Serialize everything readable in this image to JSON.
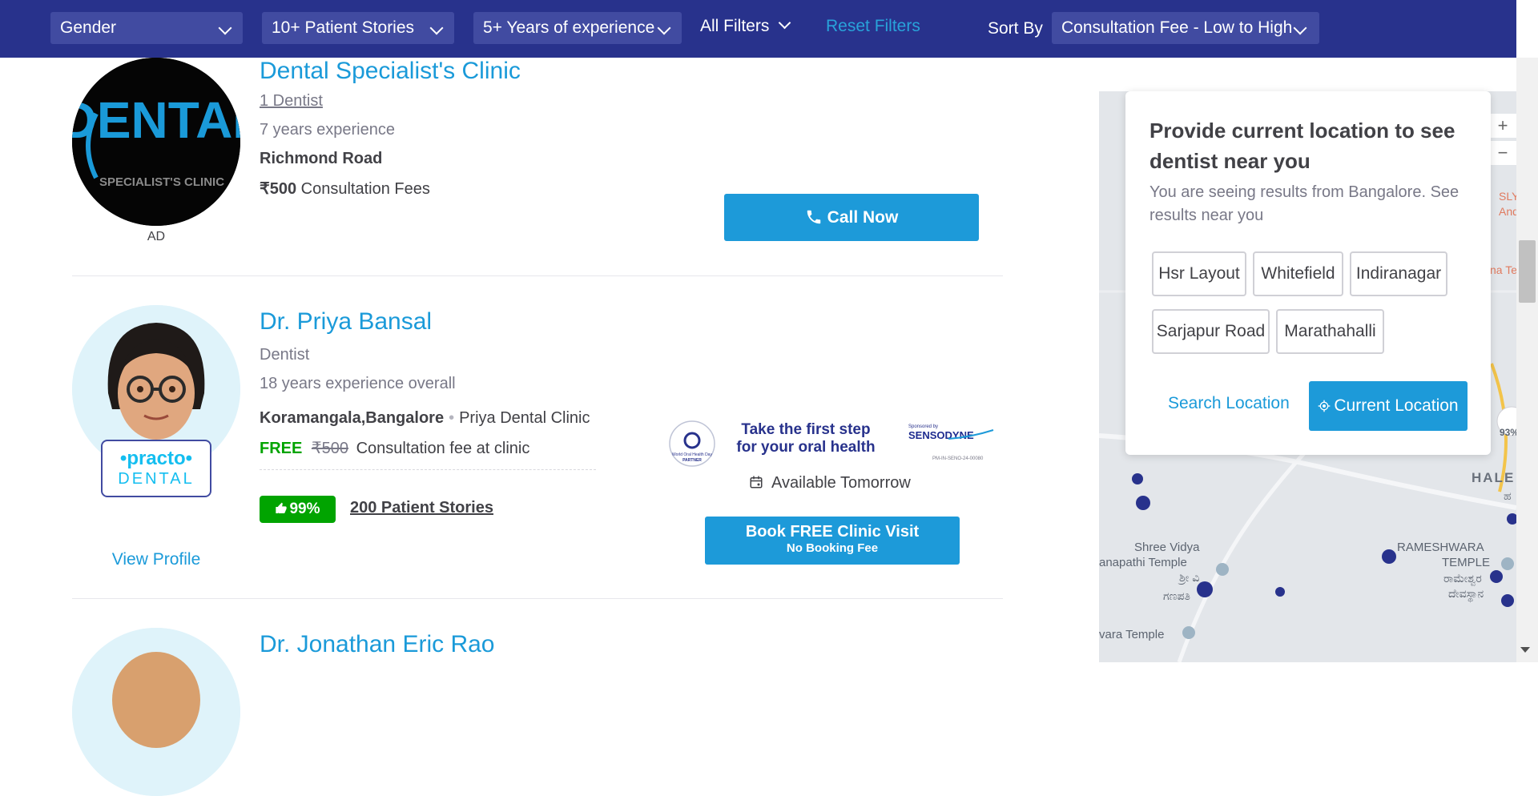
{
  "filters": {
    "gender": "Gender",
    "stories": "10+ Patient Stories",
    "experience": "5+ Years of experience",
    "all_filters": "All Filters",
    "reset": "Reset Filters",
    "sort_by_label": "Sort By",
    "sort_value": "Consultation Fee - Low to High"
  },
  "listings": [
    {
      "name": "Dental Specialist's Clinic",
      "specialty": "1 Dentist",
      "experience": "7 years experience",
      "location": "Richmond Road",
      "fee": "₹500",
      "fee_label": "Consultation Fees",
      "ad_label": "AD",
      "cta": "Call Now",
      "logo_text_top": "DENTAL",
      "logo_text_bottom": "SPECIALIST'S CLINIC"
    },
    {
      "name": "Dr. Priya Bansal",
      "specialty": "Dentist",
      "experience": "18 years experience overall",
      "location": "Koramangala,Bangalore",
      "clinic": "Priya Dental Clinic",
      "free": "FREE",
      "old_fee": "₹500",
      "fee_label": "Consultation fee at clinic",
      "rating": "99%",
      "stories": "200 Patient Stories",
      "view_profile": "View Profile",
      "promo_text": "Take the first step for your oral health",
      "availability": "Available Tomorrow",
      "cta_main": "Book FREE Clinic Visit",
      "cta_sub": "No Booking Fee",
      "partner_brand": "•practo•",
      "partner_sub": "DENTAL",
      "sponsor": "SENSODYNE",
      "sponsored_by": "Sponsored by",
      "partner_label": "PARTNER",
      "wohd": "World Oral Health Day",
      "sponsor_code": "PM-IN-SENO-24-00080"
    },
    {
      "name": "Dr. Jonathan Eric Rao"
    }
  ],
  "location_popup": {
    "title": "Provide current location to see dentist near you",
    "subtitle": "You are seeing results from Bangalore. See results near you",
    "chips": [
      "Hsr Layout",
      "Whitefield",
      "Indiranagar",
      "Sarjapur Road",
      "Marathahalli"
    ],
    "search_location": "Search Location",
    "current_location": "Current Location"
  },
  "map": {
    "zoom_in": "+",
    "zoom_out": "−",
    "labels": {
      "shree": "Shree Vidya",
      "ganapathi": "anapathi Temple",
      "rameshwara": "RAMESHWARA",
      "temple": "TEMPLE",
      "hale": "HALE",
      "vara": "vara Temple",
      "rating": "93%",
      "sly": "SLY",
      "and": "And",
      "na": "na Tem",
      "kn_ganapathi": "ಶ್ರೀ ವಿ",
      "kn_ganapathi2": "ಗಣಪತಿ",
      "kn_rameshwara": "ರಾಮೇಶ್ವರ",
      "kn_temple": "ದೇವಸ್ಥಾನ",
      "kn_hale": "ಹ"
    }
  },
  "colors": {
    "header_bg": "#28328c",
    "select_bg": "#414ba1",
    "accent": "#1d9ad9",
    "link": "#1a9ad9",
    "success": "#01a400"
  }
}
